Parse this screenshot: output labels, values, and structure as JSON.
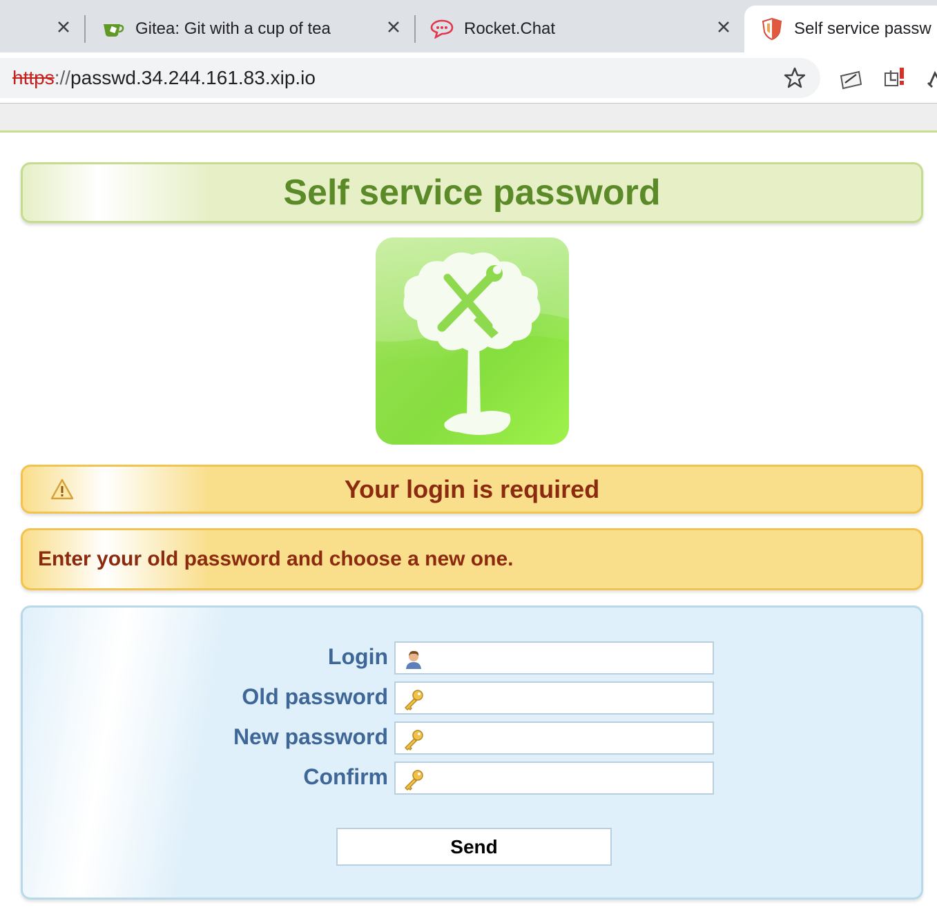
{
  "browser": {
    "tabs": [
      {
        "label": "Gitea: Git with a cup of tea",
        "icon": "gitea-tea-icon"
      },
      {
        "label": "Rocket.Chat",
        "icon": "rocketchat-icon"
      },
      {
        "label": "Self service passw",
        "icon": "shield-icon",
        "active": true
      }
    ],
    "url": {
      "scheme": "https",
      "separator": "://",
      "host": "passwd.34.244.161.83.xip.io"
    }
  },
  "page": {
    "title": "Self service password",
    "logo": "self-service-tree-logo",
    "warning": "Your login is required",
    "instructions": "Enter your old password and choose a new one.",
    "form": {
      "fields": [
        {
          "label": "Login",
          "icon": "user-icon",
          "value": ""
        },
        {
          "label": "Old password",
          "icon": "key-icon",
          "value": ""
        },
        {
          "label": "New password",
          "icon": "key-icon",
          "value": ""
        },
        {
          "label": "Confirm",
          "icon": "key-icon",
          "value": ""
        }
      ],
      "submit_label": "Send"
    }
  },
  "colors": {
    "title_green": "#5b8a29",
    "warning_red": "#8b2a0e",
    "label_blue": "#3e6797"
  }
}
